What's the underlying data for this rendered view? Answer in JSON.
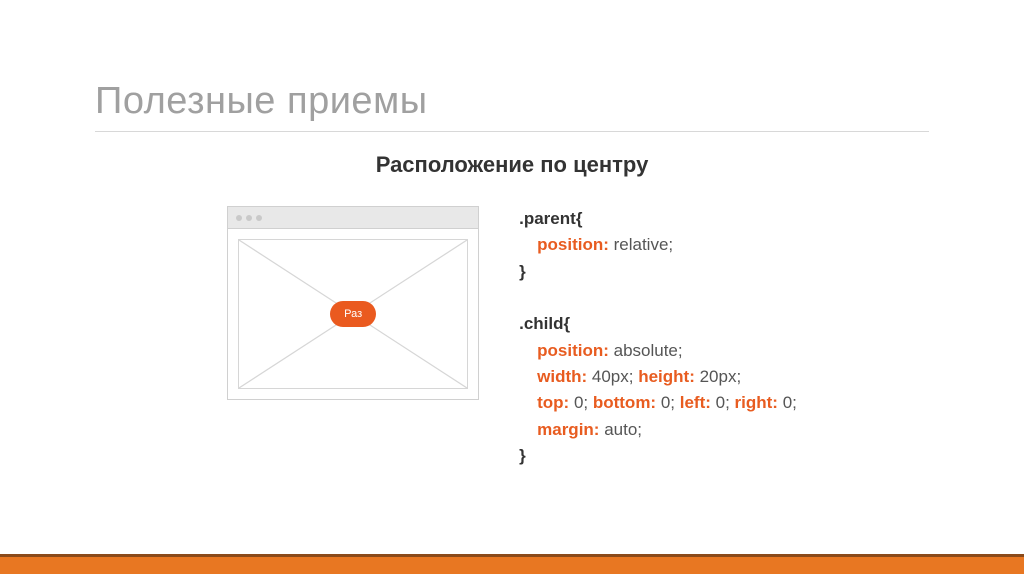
{
  "title": "Полезные приемы",
  "subtitle": "Расположение по центру",
  "pill_label": "Раз",
  "css": {
    "parent": {
      "selector": ".parent",
      "rules": [
        {
          "prop": "position",
          "val": "relative"
        }
      ]
    },
    "child": {
      "selector": ".child",
      "rules_display": {
        "line1_prop": "position:",
        "line1_val": " absolute;",
        "line2_prop1": "width:",
        "line2_val1": " 40px; ",
        "line2_prop2": "height:",
        "line2_val2": " 20px;",
        "line3_prop1": "top:",
        "line3_val1": " 0; ",
        "line3_prop2": "bottom:",
        "line3_val2": " 0; ",
        "line3_prop3": "left:",
        "line3_val3": " 0; ",
        "line3_prop4": "right:",
        "line3_val4": " 0;",
        "line4_prop": "margin:",
        "line4_val": " auto;"
      }
    }
  },
  "punct": {
    "open": "{",
    "close": "}",
    "semi": ";"
  },
  "colors": {
    "accent": "#ea5a1f",
    "footer": "#e87722",
    "footer_border": "#8a4a1a"
  }
}
